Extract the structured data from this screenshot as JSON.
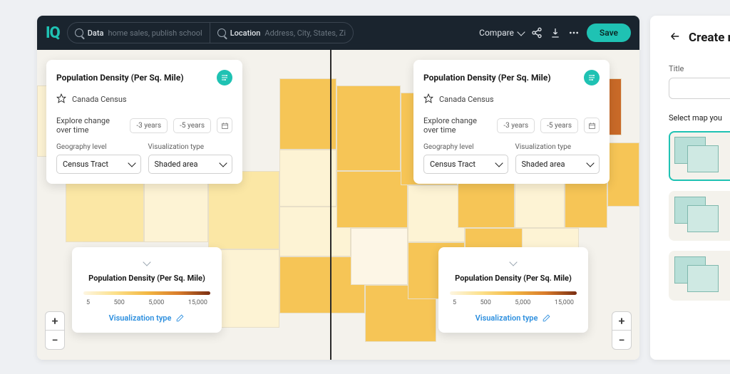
{
  "topbar": {
    "logo": "IQ",
    "data_label": "Data",
    "data_placeholder": "home sales, publish school",
    "location_label": "Location",
    "location_placeholder": "Address, City, States, Zip",
    "compare_label": "Compare",
    "save_label": "Save"
  },
  "panels": {
    "left": {
      "title": "Population Density (Per Sq. Mile)",
      "source": "Canada Census",
      "explore_label": "Explore change over time",
      "chip1": "-3 years",
      "chip2": "-5 years",
      "geo_label": "Geography level",
      "geo_value": "Census Tract",
      "viz_label": "Visualization type",
      "viz_value": "Shaded area"
    },
    "right": {
      "title": "Population Density (Per Sq. Mile)",
      "source": "Canada Census",
      "explore_label": "Explore change over time",
      "chip1": "-3 years",
      "chip2": "-5 years",
      "geo_label": "Geography level",
      "geo_value": "Census Tract",
      "viz_label": "Visualization type",
      "viz_value": "Shaded area"
    }
  },
  "legend": {
    "title": "Population Density (Per Sq. Mile)",
    "ticks": [
      "5",
      "500",
      "5,000",
      "15,000"
    ],
    "viz_link": "Visualization type"
  },
  "drawer": {
    "title": "Create r",
    "field_title": "Title",
    "select_map_label": "Select map you"
  },
  "chart_data": {
    "type": "choropleth",
    "title": "Population Density (Per Sq. Mile)",
    "scale_ticks": [
      5,
      500,
      5000,
      15000
    ],
    "geography_level": "Census Tract",
    "visualization_type": "Shaded area",
    "compare_views": 2,
    "source": "Canada Census"
  }
}
